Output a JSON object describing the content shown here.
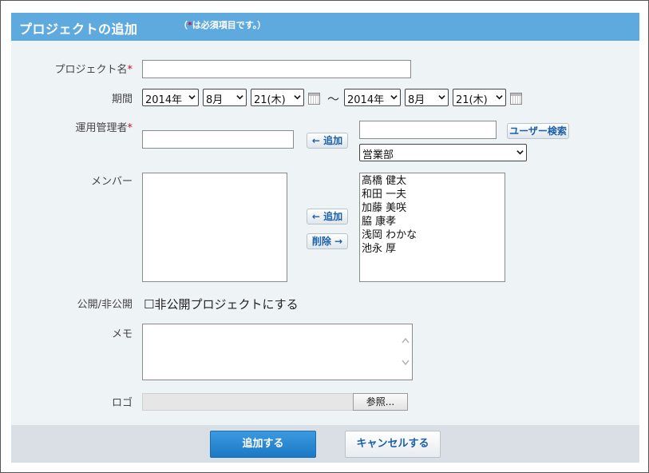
{
  "header": {
    "title": "プロジェクトの追加",
    "note_open": "（",
    "note_star": "*",
    "note_rest": "は必須項目です。）"
  },
  "form": {
    "project_name": {
      "label": "プロジェクト名",
      "required_mark": "*",
      "value": ""
    },
    "period": {
      "label": "期間",
      "start": {
        "year": "2014年",
        "month": "8月",
        "day": "21(木)"
      },
      "separator": "〜",
      "end": {
        "year": "2014年",
        "month": "8月",
        "day": "21(木)"
      }
    },
    "manager": {
      "label": "運用管理者",
      "required_mark": "*",
      "value": "",
      "add_button": "← 追加",
      "search_value": "",
      "user_search_button": "ユーザー検索",
      "department_select": "営業部"
    },
    "members": {
      "label": "メンバー",
      "add_button": "← 追加",
      "remove_button": "削除 →",
      "candidates": [
        "高橋 健太",
        "和田 一夫",
        "加藤 美咲",
        "脇 康孝",
        "浅岡 わかな",
        "池永 厚"
      ]
    },
    "visibility": {
      "label": "公開/非公開",
      "checkbox_glyph": "☐",
      "checkbox_label": "非公開プロジェクトにする"
    },
    "memo": {
      "label": "メモ",
      "value": ""
    },
    "logo": {
      "label": "ロゴ",
      "browse_button": "参照..."
    }
  },
  "footer": {
    "submit_button": "追加する",
    "cancel_button": "キャンセルする"
  }
}
